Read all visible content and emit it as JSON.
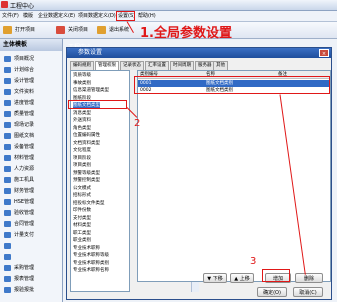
{
  "app": {
    "title": "工程中心"
  },
  "menu": [
    "文件(F)",
    "模版",
    "企业数据定义(E)",
    "项目数据定义(D)",
    "设置(S)",
    "帮助(H)"
  ],
  "toolbar": [
    {
      "label": "打开项目",
      "icon": "open-icon",
      "color": "#e0a030"
    },
    {
      "label": "关闭项目",
      "icon": "close-project-icon",
      "color": "#d94c3c"
    },
    {
      "label": "退出系统",
      "icon": "exit-icon",
      "color": "#e0a030"
    }
  ],
  "sidebar": {
    "title": "主体模板",
    "items": [
      "项目概况",
      "计划综合",
      "设计管理",
      "文件资料",
      "进度管理",
      "质量管理",
      "现场记录",
      "图纸文档",
      "设备管理",
      "材料管理",
      "人力资源",
      "施工机具",
      "财务管理",
      "HSE管理",
      "验收管理",
      "合同管理",
      "计量支付",
      "",
      "",
      "采购管理",
      "报表管理",
      "报验报批"
    ]
  },
  "workspace": {
    "tab": "工程中心"
  },
  "dialog": {
    "title": "参数设置",
    "close_label": "×",
    "tabs": [
      "编码规则",
      "管理权限",
      "记录状态",
      "汇率设置",
      "时间周期",
      "服务器",
      "其他"
    ],
    "tree": [
      "资质等级",
      "事故类别",
      "信息渠道管理类型",
      "图纸阶段",
      "图纸文档类型",
      "消息类型",
      "外送资料",
      "角色类型",
      "位置编码属性",
      "文档资料类型",
      "文化程度",
      "项目阶段",
      "项目类别",
      "预警等级类型",
      "预警控制类型",
      "公文模式",
      "招标形式",
      "招投标文件类型",
      "印件份数",
      "支付类型",
      "材料类型",
      "职工类型",
      "职业类别",
      "专业技术职称",
      "专业技术职称等级",
      "专业技术职称类别",
      "专业技术职称名称"
    ],
    "tree_selected": 4,
    "columns": [
      "类别编号",
      "名称",
      "备注"
    ],
    "rows": [
      {
        "code": "0001",
        "name": "图纸文档类别"
      },
      {
        "code": "0002",
        "name": "图纸文档类别"
      }
    ],
    "buttons": {
      "down": "下移",
      "up": "上移",
      "add": "增加",
      "delete": "删除",
      "ok": "确定(O)",
      "cancel": "取消(C)"
    }
  },
  "annotations": {
    "step1": "1.全局参数设置",
    "step2": "2",
    "step3": "3"
  }
}
